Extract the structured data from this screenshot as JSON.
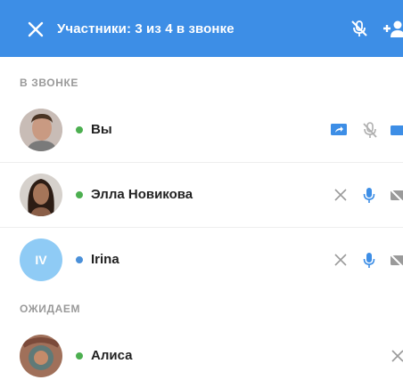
{
  "header": {
    "title": "Участники: 3 из 4 в звонке",
    "bg_color": "#3d8ee6",
    "icons": [
      "close-icon",
      "mic-off-icon",
      "add-user-icon"
    ]
  },
  "sections": {
    "in_call": "В ЗВОНКЕ",
    "waiting": "ОЖИДАЕМ"
  },
  "participants": [
    {
      "name": "Вы",
      "status_color": "#4caf50",
      "avatar": "photo",
      "actions": [
        "screen-share-icon",
        "mic-off-icon",
        "camera-icon"
      ]
    },
    {
      "name": "Элла Новикова",
      "status_color": "#4caf50",
      "avatar": "photo",
      "actions": [
        "remove-icon",
        "mic-icon",
        "camera-off-icon"
      ]
    },
    {
      "name": "Irina",
      "status_color": "#4a90d9",
      "avatar_initials": "IV",
      "avatar_color": "#8fcbf5",
      "actions": [
        "remove-icon",
        "mic-icon",
        "camera-off-icon"
      ]
    }
  ],
  "waiting": [
    {
      "name": "Алиса",
      "status_color": "#4caf50",
      "avatar": "photo",
      "actions": [
        "remove-icon"
      ]
    }
  ]
}
